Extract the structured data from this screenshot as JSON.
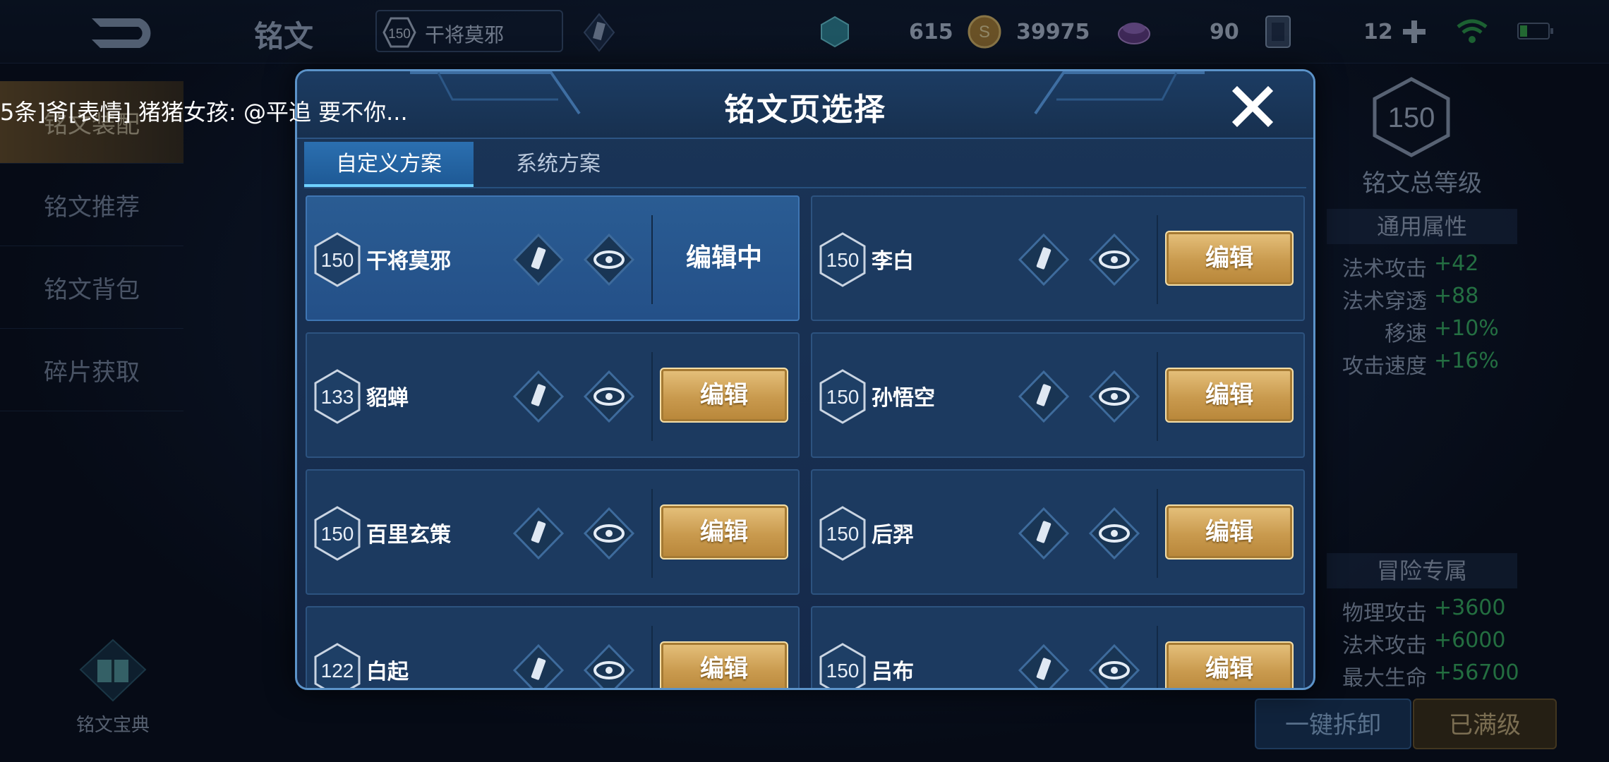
{
  "topbar": {
    "title": "铭文",
    "chip_level": "150",
    "chip_name": "干将莫邪",
    "currencies": [
      {
        "icon": "crystal-icon",
        "value": "615"
      },
      {
        "icon": "gold-coin-icon",
        "value": "39975"
      },
      {
        "icon": "gem-icon",
        "value": "90"
      },
      {
        "icon": "card-icon",
        "value": "12"
      }
    ]
  },
  "leftnav": {
    "items": [
      "铭文装配",
      "铭文推荐",
      "铭文背包",
      "碎片获取"
    ],
    "codex_label": "铭文宝典"
  },
  "chat": {
    "text": "5条]爷[表情] 猪猪女孩: @平追 要不你..."
  },
  "modal": {
    "title": "铭文页选择",
    "tabs": [
      "自定义方案",
      "系统方案"
    ],
    "edit_label": "编辑",
    "editing_label": "编辑中",
    "pages": [
      {
        "level": "150",
        "name": "干将莫邪",
        "current": true
      },
      {
        "level": "150",
        "name": "李白",
        "current": false
      },
      {
        "level": "133",
        "name": "貂蝉",
        "current": false
      },
      {
        "level": "150",
        "name": "孙悟空",
        "current": false
      },
      {
        "level": "150",
        "name": "百里玄策",
        "current": false
      },
      {
        "level": "150",
        "name": "后羿",
        "current": false
      },
      {
        "level": "122",
        "name": "白起",
        "current": false
      },
      {
        "level": "150",
        "name": "吕布",
        "current": false
      }
    ]
  },
  "right": {
    "total_level": "150",
    "total_label": "铭文总等级",
    "general_head": "通用属性",
    "general": [
      {
        "name": "法术攻击",
        "value": "+42"
      },
      {
        "name": "法术穿透",
        "value": "+88"
      },
      {
        "name": "移速",
        "value": "+10%"
      },
      {
        "name": "攻击速度",
        "value": "+16%"
      }
    ],
    "adventure_head": "冒险专属",
    "adventure": [
      {
        "name": "物理攻击",
        "value": "+3600"
      },
      {
        "name": "法术攻击",
        "value": "+6000"
      },
      {
        "name": "最大生命",
        "value": "+56700"
      }
    ],
    "unload_label": "一键拆卸",
    "maxed_label": "已满级"
  }
}
